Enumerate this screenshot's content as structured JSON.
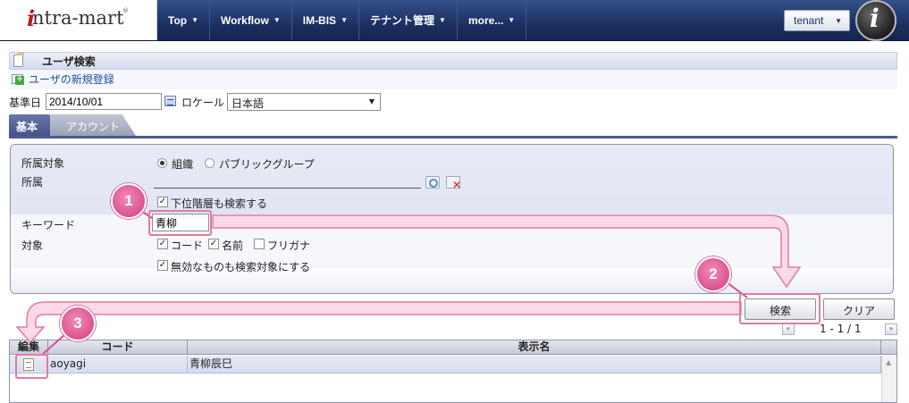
{
  "header": {
    "logo_text": "ntra-mart",
    "logo_i": "i",
    "logo_reg": "®",
    "nav": [
      {
        "label": "Top"
      },
      {
        "label": "Workflow"
      },
      {
        "label": "IM-BIS"
      },
      {
        "label": "テナント管理"
      },
      {
        "label": "more..."
      }
    ],
    "tenant": "tenant",
    "avatar_letter": "i"
  },
  "page": {
    "title": "ユーザ検索",
    "new_user_link": "ユーザの新規登録"
  },
  "filters": {
    "base_date_label": "基準日",
    "base_date_value": "2014/10/01",
    "locale_label": "ロケール",
    "locale_value": "日本語"
  },
  "tabs": [
    {
      "label": "基本",
      "active": true
    },
    {
      "label": "アカウント",
      "active": false
    }
  ],
  "search_form": {
    "affiliation_target_label": "所属対象",
    "radio_org": "組織",
    "radio_public_group": "パブリックグループ",
    "affiliation_label": "所属",
    "include_sub_label": "下位階層も検索する",
    "keyword_label": "キーワード",
    "keyword_value": "青柳",
    "target_label": "対象",
    "target_code": "コード",
    "target_name": "名前",
    "target_kana": "フリガナ",
    "include_invalid_label": "無効なものも検索対象にする"
  },
  "buttons": {
    "search": "検索",
    "clear": "クリア"
  },
  "pager": {
    "text": "1 - 1 / 1",
    "prev": "«",
    "next": "»"
  },
  "grid": {
    "columns": [
      "編集",
      "コード",
      "表示名"
    ],
    "rows": [
      {
        "code": "aoyagi",
        "display_name": "青柳辰巳"
      }
    ]
  },
  "annotations": {
    "step1": "1",
    "step2": "2",
    "step3": "3"
  },
  "colors": {
    "nav_bg": "#1c3062",
    "tab_active": "#45528a",
    "annotation_pink": "#e27aa6"
  },
  "icons": {
    "page": "page-icon",
    "add": "add-user-icon",
    "calendar": "calendar-icon",
    "org_search": "search-icon",
    "org_clear": "clear-icon",
    "edit": "edit-icon"
  }
}
